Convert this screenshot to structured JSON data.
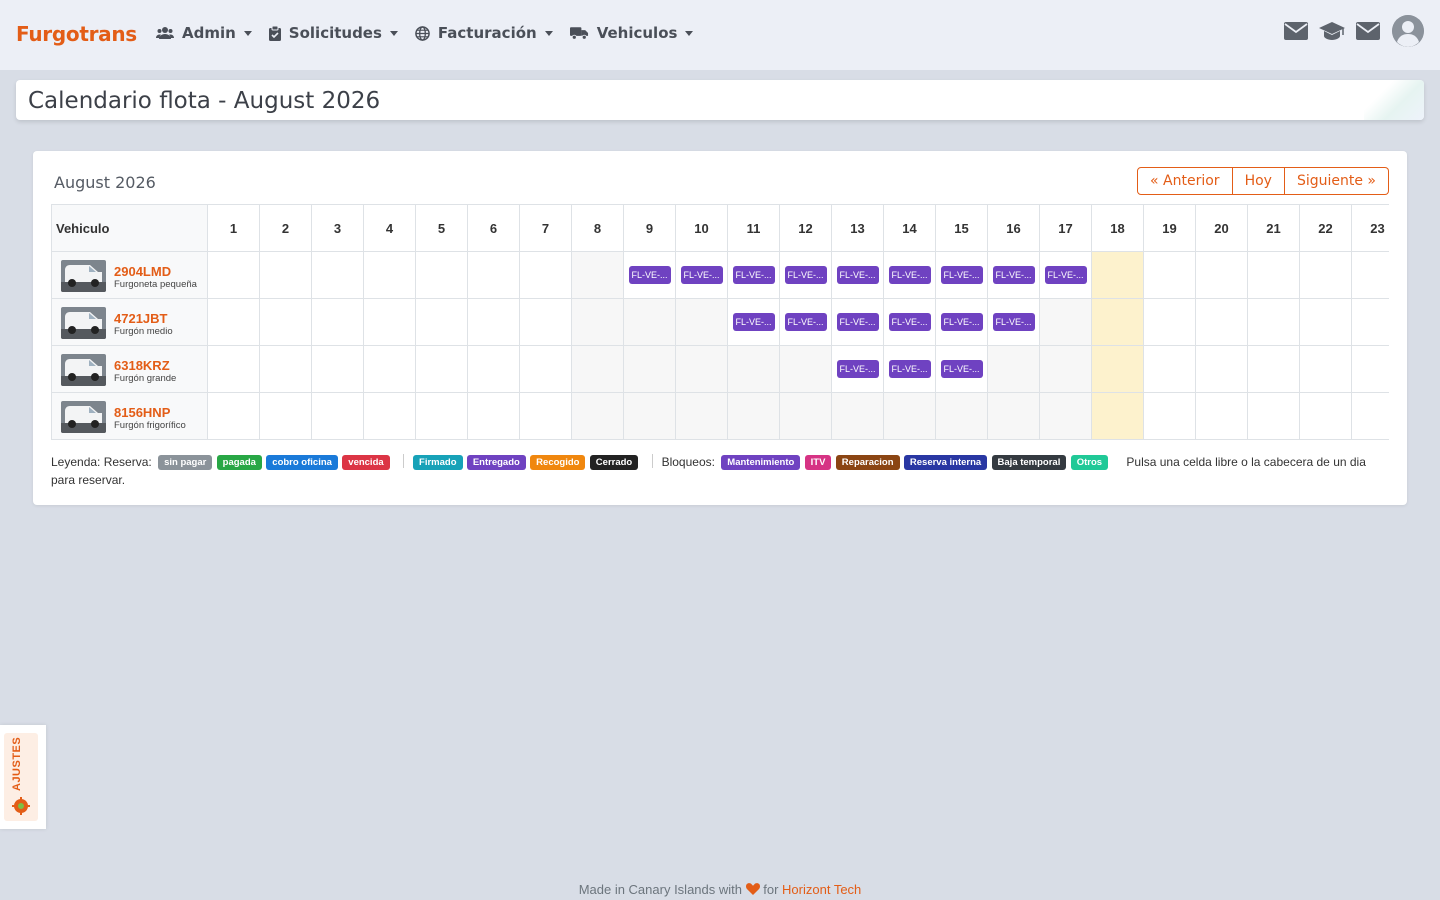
{
  "navbar": {
    "brand": "Furgotrans",
    "menu": [
      {
        "label": "Admin",
        "icon": "users-icon"
      },
      {
        "label": "Solicitudes",
        "icon": "clipboard-check-icon"
      },
      {
        "label": "Facturación",
        "icon": "globe-icon"
      },
      {
        "label": "Vehiculos",
        "icon": "truck-icon"
      }
    ],
    "right_icons": [
      "envelope-icon",
      "graduation-cap-icon",
      "envelope-icon",
      "user-avatar"
    ]
  },
  "page": {
    "title": "Calendario flota - August 2026"
  },
  "calendar": {
    "month_label": "August 2026",
    "nav": {
      "prev": "« Anterior",
      "today": "Hoy",
      "next": "Siguiente »"
    },
    "vehicle_header": "Vehiculo",
    "days": [
      "1",
      "2",
      "3",
      "4",
      "5",
      "6",
      "7",
      "8",
      "9",
      "10",
      "11",
      "12",
      "13",
      "14",
      "15",
      "16",
      "17",
      "18",
      "19",
      "20",
      "21",
      "22",
      "23"
    ],
    "today_day": "18",
    "vehicles": [
      {
        "plate": "2904LMD",
        "type": "Furgoneta pequeña",
        "reservations": [
          9,
          10,
          11,
          12,
          13,
          14,
          15,
          16,
          17
        ]
      },
      {
        "plate": "4721JBT",
        "type": "Furgón medio",
        "reservations": [
          11,
          12,
          13,
          14,
          15,
          16
        ]
      },
      {
        "plate": "6318KRZ",
        "type": "Furgón grande",
        "reservations": [
          13,
          14,
          15
        ]
      },
      {
        "plate": "8156HNP",
        "type": "Furgón frigorífico",
        "reservations": []
      }
    ],
    "reservation_label": "FL-VE-...",
    "reservation_color": "#6f42c1",
    "today_color": "#fdf2cd"
  },
  "legend": {
    "reserva_label": "Leyenda: Reserva:",
    "reserva_badges": [
      {
        "label": "sin pagar",
        "color": "#8b939a"
      },
      {
        "label": "pagada",
        "color": "#28a745"
      },
      {
        "label": "cobro oficina",
        "color": "#1a7ad9"
      },
      {
        "label": "vencida",
        "color": "#dc3545"
      }
    ],
    "estado_badges": [
      {
        "label": "Firmado",
        "color": "#17a2b8"
      },
      {
        "label": "Entregado",
        "color": "#6f42c1"
      },
      {
        "label": "Recogido",
        "color": "#f0870e"
      },
      {
        "label": "Cerrado",
        "color": "#222222"
      }
    ],
    "bloqueos_label": "Bloqueos:",
    "bloqueo_badges": [
      {
        "label": "Mantenimiento",
        "color": "#6f42c1"
      },
      {
        "label": "ITV",
        "color": "#d63384"
      },
      {
        "label": "Reparacion",
        "color": "#8b4513"
      },
      {
        "label": "Reserva interna",
        "color": "#2937a3"
      },
      {
        "label": "Baja temporal",
        "color": "#343a40"
      },
      {
        "label": "Otros",
        "color": "#20c997"
      }
    ],
    "hint": "Pulsa una celda libre o la cabecera de un dia para reservar."
  },
  "settings_tab": {
    "label": "AJUSTES",
    "icon": "gear-icon"
  },
  "footer": {
    "text": "Made in Canary Islands with",
    "for": "for",
    "link": "Horizont Tech",
    "heart_color": "#e35d17"
  }
}
